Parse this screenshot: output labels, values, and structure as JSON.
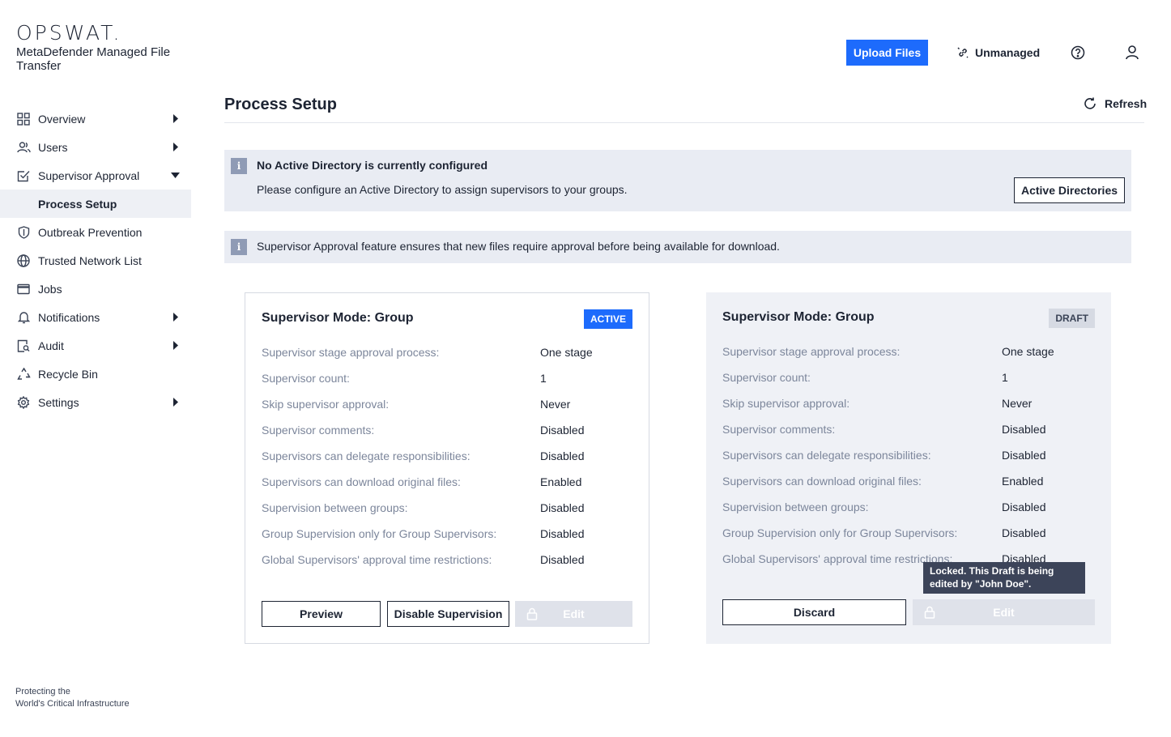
{
  "brand": {
    "logo": "OPSWAT.",
    "product_name": "MetaDefender Managed File Transfer",
    "tagline_line1": "Protecting the",
    "tagline_line2": "World's Critical Infrastructure"
  },
  "sidebar": {
    "items": [
      {
        "label": "Overview",
        "icon": "grid-icon",
        "has_arrow": true
      },
      {
        "label": "Users",
        "icon": "users-icon",
        "has_arrow": true
      },
      {
        "label": "Supervisor Approval",
        "icon": "checkbox-icon",
        "expanded": true
      },
      {
        "label": "Process Setup",
        "selected": true
      },
      {
        "label": "Outbreak Prevention",
        "icon": "shield-icon"
      },
      {
        "label": "Trusted Network List",
        "icon": "globe-icon"
      },
      {
        "label": "Jobs",
        "icon": "jobs-icon"
      },
      {
        "label": "Notifications",
        "icon": "bell-icon",
        "has_arrow": true
      },
      {
        "label": "Audit",
        "icon": "audit-icon",
        "has_arrow": true
      },
      {
        "label": "Recycle Bin",
        "icon": "recycle-icon"
      },
      {
        "label": "Settings",
        "icon": "gear-icon",
        "has_arrow": true
      }
    ]
  },
  "header": {
    "upload_label": "Upload Files",
    "unmanaged_label": "Unmanaged",
    "help_icon": "help-icon",
    "user_icon": "user-icon"
  },
  "page": {
    "title": "Process Setup",
    "refresh_label": "Refresh"
  },
  "alerts": {
    "ad": {
      "title": "No Active Directory is currently configured",
      "message": "Please configure an Active Directory to assign supervisors to your groups.",
      "button": "Active Directories",
      "badge": "i"
    },
    "feature": {
      "message": "Supervisor Approval feature ensures that new files require approval before being available for download.",
      "badge": "i"
    }
  },
  "cards": {
    "active": {
      "title": "Supervisor Mode: Group",
      "status": "ACTIVE",
      "rows": [
        {
          "k": "Supervisor stage approval process:",
          "v": "One stage"
        },
        {
          "k": "Supervisor count:",
          "v": "1"
        },
        {
          "k": "Skip supervisor approval:",
          "v": "Never"
        },
        {
          "k": "Supervisor comments:",
          "v": "Disabled"
        },
        {
          "k": "Supervisors can delegate responsibilities:",
          "v": "Disabled"
        },
        {
          "k": "Supervisors can download original files:",
          "v": "Enabled"
        },
        {
          "k": "Supervision between groups:",
          "v": "Disabled"
        },
        {
          "k": "Group Supervision only for Group Supervisors:",
          "v": "Disabled"
        },
        {
          "k": "Global Supervisors' approval time restrictions:",
          "v": "Disabled"
        }
      ],
      "buttons": {
        "preview": "Preview",
        "disable": "Disable Supervision",
        "edit": "Edit"
      }
    },
    "draft": {
      "title": "Supervisor Mode: Group",
      "status": "DRAFT",
      "rows": [
        {
          "k": "Supervisor stage approval process:",
          "v": "One stage"
        },
        {
          "k": "Supervisor count:",
          "v": "1"
        },
        {
          "k": "Skip supervisor approval:",
          "v": "Never"
        },
        {
          "k": "Supervisor comments:",
          "v": "Disabled"
        },
        {
          "k": "Supervisors can delegate responsibilities:",
          "v": "Disabled"
        },
        {
          "k": "Supervisors can download original files:",
          "v": "Enabled"
        },
        {
          "k": "Supervision between groups:",
          "v": "Disabled"
        },
        {
          "k": "Group Supervision only for Group Supervisors:",
          "v": "Disabled"
        },
        {
          "k": "Global Supervisors' approval time restrictions:",
          "v": "Disabled"
        }
      ],
      "buttons": {
        "discard": "Discard",
        "edit": "Edit"
      },
      "tooltip": "Locked. This Draft is being edited by \"John Doe\"."
    }
  },
  "colors": {
    "accent": "#1d6bfc",
    "text": "#1d2433",
    "muted": "#7c869b",
    "alert_bg": "#e9ecf3"
  }
}
